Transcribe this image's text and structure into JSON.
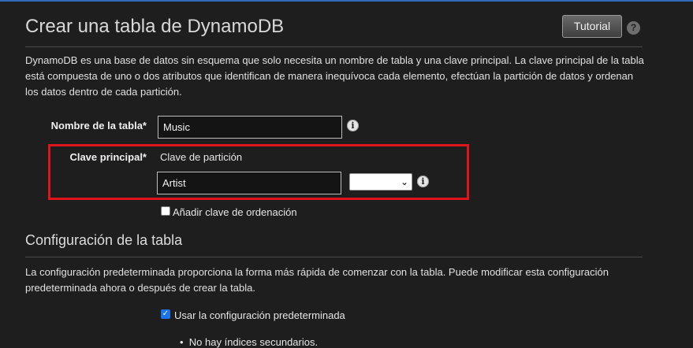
{
  "header": {
    "title": "Crear una tabla de DynamoDB",
    "tutorial_label": "Tutorial",
    "help_symbol": "?"
  },
  "intro": {
    "description": "DynamoDB es una base de datos sin esquema que solo necesita un nombre de tabla y una clave principal. La clave principal de la tabla está compuesta de uno o dos atributos que identifican de manera inequívoca cada elemento, efectúan la partición de datos y ordenan los datos dentro de cada partición."
  },
  "form": {
    "table_name_label": "Nombre de la tabla*",
    "table_name_value": "Music",
    "primary_key_label": "Clave principal*",
    "partition_key_label": "Clave de partición",
    "partition_key_value": "Artist",
    "partition_key_type": "",
    "sort_key_checkbox_label": "Añadir clave de ordenación",
    "sort_key_checked": false,
    "info_symbol": "i"
  },
  "table_settings": {
    "title": "Configuración de la tabla",
    "description": "La configuración predeterminada proporciona la forma más rápida de comenzar con la tabla. Puede modificar esta configuración predeterminada ahora o después de crear la tabla.",
    "use_defaults_label": "Usar la configuración predeterminada",
    "use_defaults_checked": true,
    "bullets": [
      "No hay índices secundarios."
    ]
  },
  "colors": {
    "background": "#1e1e1e",
    "highlight_border": "#e0141b",
    "checkbox_accent": "#1a73e8"
  }
}
